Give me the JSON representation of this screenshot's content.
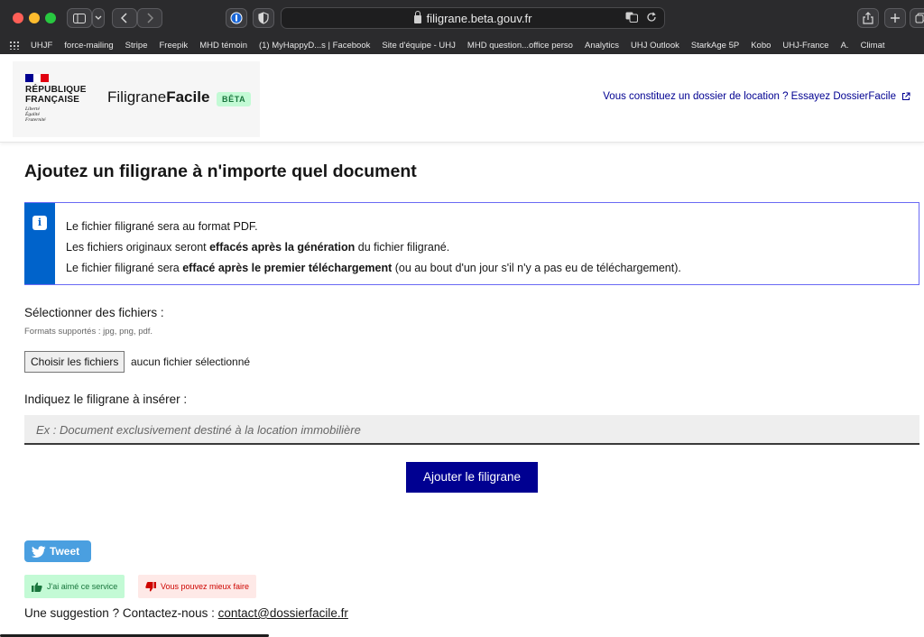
{
  "browser": {
    "url": "filigrane.beta.gouv.fr",
    "bookmarks": [
      "UHJF",
      "force-mailing",
      "Stripe",
      "Freepik",
      "MHD témoin",
      "(1) MyHappyD...s | Facebook",
      "Site d'équipe - UHJ",
      "MHD question...office perso",
      "Analytics",
      "UHJ Outlook",
      "StarkAge 5P",
      "Kobo",
      "UHJ-France",
      "A.",
      "Climat"
    ]
  },
  "header": {
    "marianne_line1": "RÉPUBLIQUE",
    "marianne_line2": "FRANÇAISE",
    "devise_1": "Liberté",
    "devise_2": "Égalité",
    "devise_3": "Fraternité",
    "service_name_regular": "Filigrane",
    "service_name_bold": "Facile",
    "beta_badge": "BÊTA",
    "external_link": "Vous constituez un dossier de location ? Essayez DossierFacile"
  },
  "main": {
    "title": "Ajoutez un filigrane à n'importe quel document",
    "info": {
      "line1": "Le fichier filigrané sera au format PDF.",
      "line2_pre": "Les fichiers originaux seront ",
      "line2_bold": "effacés après la génération",
      "line2_post": " du fichier filigrané.",
      "line3_pre": "Le fichier filigrané sera ",
      "line3_bold": "effacé après le premier téléchargement",
      "line3_post": " (ou au bout d'un jour s'il n'y a pas eu de téléchargement)."
    },
    "files_label": "Sélectionner des fichiers :",
    "files_hint": "Formats supportés : jpg, png, pdf.",
    "file_button": "Choisir les fichiers",
    "file_status": "aucun fichier sélectionné",
    "watermark_label": "Indiquez le filigrane à insérer :",
    "watermark_placeholder": "Ex : Document exclusivement destiné à la location immobilière",
    "submit_label": "Ajouter le filigrane"
  },
  "footer": {
    "tweet_label": "Tweet",
    "like_label": "J'ai aimé ce service",
    "dislike_label": "Vous pouvez mieux faire",
    "contact_text": "Une suggestion ? Contactez-nous : ",
    "contact_email": "contact@dossierfacile.fr"
  },
  "colors": {
    "primary": "#000091",
    "info_blue": "#0063cb",
    "like_bg": "#c3fad5",
    "dislike_bg": "#fee9e7"
  }
}
